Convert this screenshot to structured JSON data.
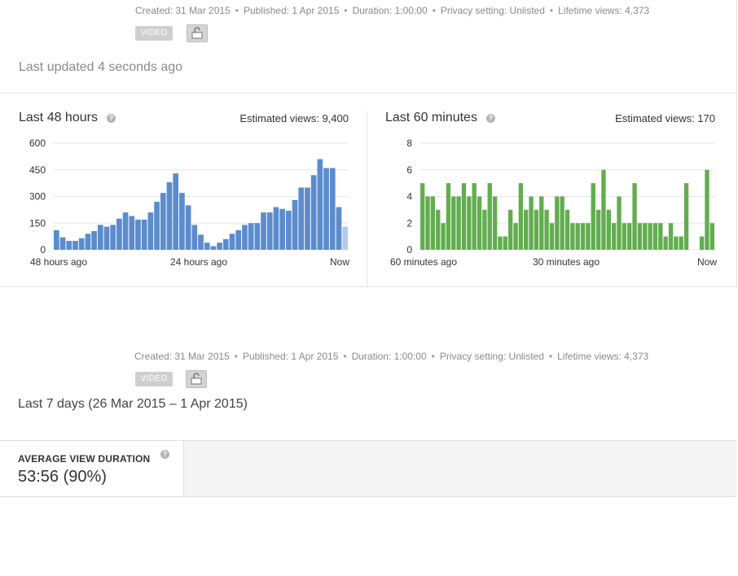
{
  "meta": {
    "created": "Created: 31 Mar 2015",
    "published": "Published: 1 Apr 2015",
    "duration": "Duration: 1:00:00",
    "privacy": "Privacy setting: Unlisted",
    "lifetime": "Lifetime views: 4,373",
    "separator": "•"
  },
  "badge": {
    "label": "VIDEO"
  },
  "updated": "Last updated 4 seconds ago",
  "panels": {
    "left": {
      "title": "Last 48 hours",
      "estimated": "Estimated views: 9,400",
      "x_labels": [
        "48 hours ago",
        "24 hours ago",
        "Now"
      ]
    },
    "right": {
      "title": "Last 60 minutes",
      "estimated": "Estimated views: 170",
      "x_labels": [
        "60 minutes ago",
        "30 minutes ago",
        "Now"
      ]
    }
  },
  "section2": {
    "title": "Last 7 days (26 Mar 2015 – 1 Apr 2015)"
  },
  "metric": {
    "label": "AVERAGE VIEW DURATION",
    "value": "53:56 (90%)"
  },
  "colors": {
    "bar_blue": "#5b8ccc",
    "bar_blue_current": "#b3cbe9",
    "bar_green": "#62ad4f",
    "grid": "#e6e6e6"
  },
  "chart_data": [
    {
      "type": "bar",
      "ylim": [
        0,
        600
      ],
      "yticks": [
        0,
        150,
        300,
        450,
        600
      ],
      "values": [
        110,
        70,
        50,
        50,
        65,
        90,
        105,
        140,
        130,
        140,
        175,
        210,
        190,
        170,
        170,
        210,
        270,
        320,
        380,
        430,
        320,
        250,
        140,
        85,
        40,
        20,
        40,
        60,
        90,
        110,
        140,
        150,
        150,
        210,
        210,
        240,
        230,
        220,
        280,
        350,
        350,
        420,
        510,
        460,
        460,
        240,
        130
      ],
      "current_index": 46
    },
    {
      "type": "bar",
      "ylim": [
        0,
        8
      ],
      "yticks": [
        0,
        2,
        4,
        6,
        8
      ],
      "values": [
        5,
        4,
        4,
        3,
        2,
        5,
        4,
        4,
        5,
        4,
        5,
        4,
        3,
        5,
        4,
        1,
        1,
        3,
        2,
        5,
        3,
        4,
        3,
        4,
        3,
        2,
        4,
        4,
        3,
        2,
        2,
        2,
        2,
        5,
        3,
        6,
        3,
        2,
        4,
        2,
        2,
        5,
        2,
        2,
        2,
        2,
        2,
        1,
        2,
        1,
        1,
        5,
        0,
        0,
        1,
        6,
        2
      ]
    }
  ]
}
